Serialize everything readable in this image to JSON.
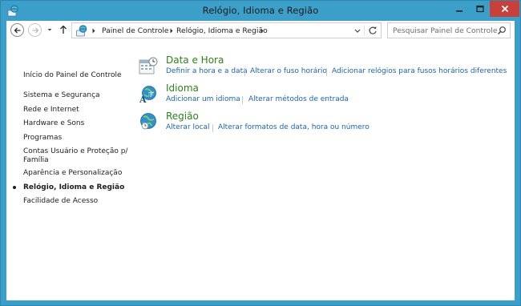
{
  "window": {
    "title": "Relógio, Idioma e Região",
    "icon": "control-panel-icon",
    "colors": {
      "frame": "#3c9fc9",
      "close_button": "#c7413a"
    }
  },
  "navigation": {
    "back_icon": "back-arrow-icon",
    "forward_icon": "forward-arrow-icon",
    "recent_icon": "chevron-down-icon",
    "up_icon": "up-arrow-icon"
  },
  "address_bar": {
    "breadcrumbs": [
      "Painel de Controle",
      "Relógio, Idioma e Região"
    ],
    "icon": "control-panel-icon",
    "refresh_icon": "refresh-icon"
  },
  "search": {
    "placeholder": "Pesquisar Painel de Controle",
    "icon": "search-icon"
  },
  "sidebar": {
    "items": [
      {
        "label": "Início do Painel de Controle"
      },
      {
        "label": "Sistema e Segurança"
      },
      {
        "label": "Rede e Internet"
      },
      {
        "label": "Hardware e Sons"
      },
      {
        "label": "Programas"
      },
      {
        "label": "Contas Usuário e Proteção p/"
      },
      {
        "label": "Família"
      },
      {
        "label": "Aparência e Personalização"
      },
      {
        "label": "Relógio, Idioma e Região",
        "active": true
      },
      {
        "label": "Facilidade de Acesso"
      }
    ]
  },
  "categories": [
    {
      "title": "Data e Hora",
      "icon": "calendar-clock-icon",
      "links": [
        "Definir a hora e a data",
        "Alterar o fuso horário",
        "Adicionar relógios para fusos horários diferentes"
      ]
    },
    {
      "title": "Idioma",
      "icon": "language-globe-icon",
      "links": [
        "Adicionar um idioma",
        "Alterar métodos de entrada"
      ]
    },
    {
      "title": "Região",
      "icon": "region-globe-icon",
      "links": [
        "Alterar local",
        "Alterar formatos de data, hora ou número"
      ]
    }
  ],
  "colors": {
    "category_title": "#2f7f1c",
    "link": "#1c63b3"
  }
}
